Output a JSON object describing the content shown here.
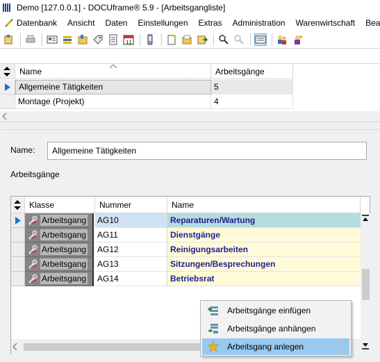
{
  "window": {
    "title": "Demo [127.0.0.1] - DOCUframe® 5.9 - [Arbeitsgangliste]"
  },
  "menu": {
    "items": [
      {
        "label": "Datenbank",
        "icon": "app-feather-icon"
      },
      {
        "label": "Ansicht"
      },
      {
        "label": "Daten"
      },
      {
        "label": "Einstellungen"
      },
      {
        "label": "Extras"
      },
      {
        "label": "Administration"
      },
      {
        "label": "Warenwirtschaft"
      },
      {
        "label": "Bearb"
      }
    ]
  },
  "toolbar": {
    "icons": [
      "new-icon",
      "print-icon",
      "card-icon",
      "list-icon",
      "folder-icon",
      "tag-icon",
      "document-icon",
      "calendar-icon",
      "mobile-icon",
      "new-doc-icon",
      "open-folder-icon",
      "export-icon",
      "search-icon",
      "search-disabled-icon",
      "form-view-icon",
      "users-icon",
      "user-star-icon"
    ]
  },
  "master_grid": {
    "columns": [
      "Name",
      "Arbeitsgänge"
    ],
    "rows": [
      {
        "name": "Allgemeine Tätigkeiten",
        "count": "5",
        "selected": true
      },
      {
        "name": "Montage (Projekt)",
        "count": "4",
        "selected": false
      }
    ]
  },
  "detail": {
    "name_label": "Name:",
    "name_value": "Allgemeine Tätigkeiten",
    "section_label": "Arbeitsgänge"
  },
  "ops_grid": {
    "columns": [
      "Klasse",
      "Nummer",
      "Name"
    ],
    "rows": [
      {
        "klasse": "Arbeitsgang",
        "nummer": "AG10",
        "name": "Reparaturen/Wartung",
        "selected": true
      },
      {
        "klasse": "Arbeitsgang",
        "nummer": "AG11",
        "name": "Dienstgänge"
      },
      {
        "klasse": "Arbeitsgang",
        "nummer": "AG12",
        "name": "Reinigungsarbeiten"
      },
      {
        "klasse": "Arbeitsgang",
        "nummer": "AG13",
        "name": "Sitzungen/Besprechungen"
      },
      {
        "klasse": "Arbeitsgang",
        "nummer": "AG14",
        "name": "Betriebsrat"
      }
    ]
  },
  "context_menu": {
    "items": [
      {
        "label": "Arbeitsgänge einfügen",
        "icon": "insert-rows-icon"
      },
      {
        "label": "Arbeitsgänge anhängen",
        "icon": "append-rows-icon"
      },
      {
        "label": "Arbeitsgang anlegen",
        "icon": "create-star-icon",
        "highlighted": true
      }
    ]
  },
  "colors": {
    "selection": "#cce4f7",
    "name_cell_bg": "#fffbd9",
    "name_text": "#1c1f8c",
    "menu_highlight": "#99c9ef"
  }
}
